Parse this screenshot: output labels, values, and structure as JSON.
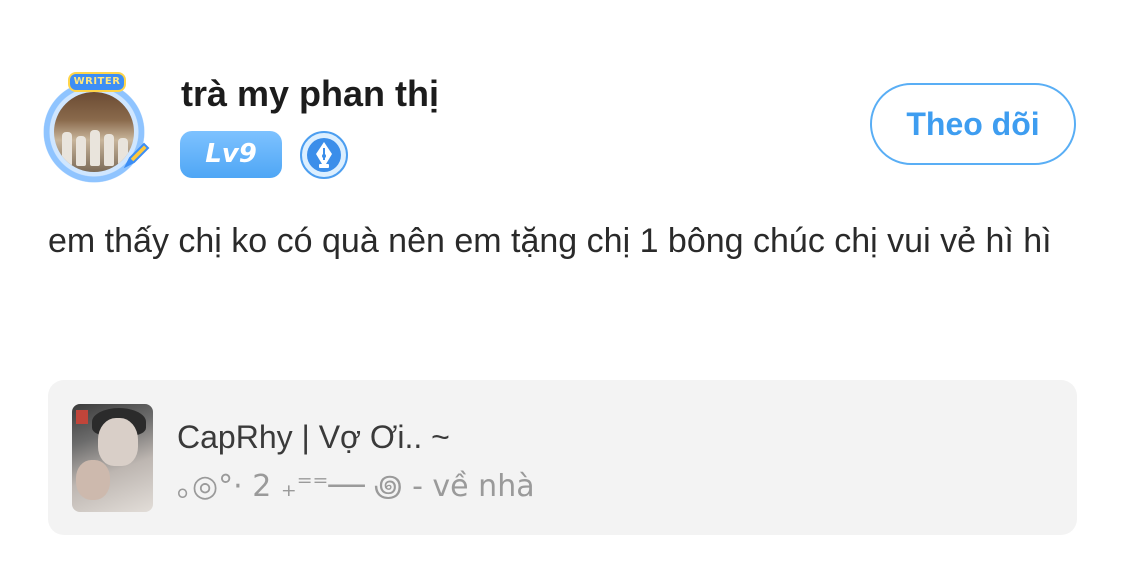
{
  "author": {
    "username": "trà my phan thị",
    "avatar_badge": "WRITER",
    "level": "Lv9",
    "writer_badge_icon": "fountain-pen-icon"
  },
  "actions": {
    "follow_label": "Theo dõi"
  },
  "post": {
    "text": "em thấy chị ko có quà nên em tặng chị 1 bông chúc chị vui vẻ hì hì"
  },
  "shared_item": {
    "title": "CapRhy | Vợ Ơi.. ~",
    "subtitle": "｡◎°· 2 ₊⁼⁼── ꩜ - về nhà"
  },
  "colors": {
    "accent": "#3e9df0",
    "follow_border": "#59aef5",
    "level_badge": "#5aaaf5",
    "card_bg": "#f3f3f3",
    "muted_text": "#9a9a9a"
  }
}
